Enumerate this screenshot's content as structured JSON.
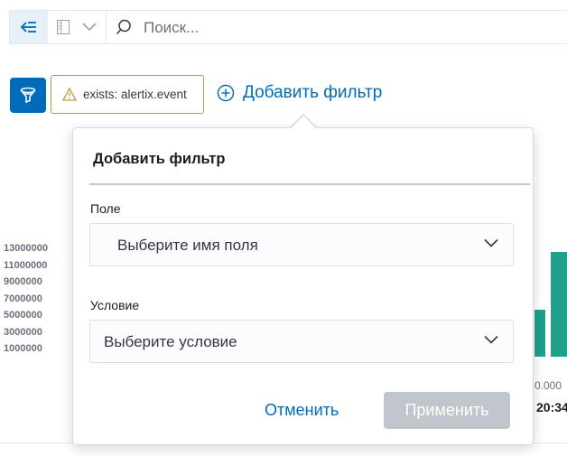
{
  "query_bar": {
    "search_placeholder": "Поиск..."
  },
  "filters": {
    "pill_label": "exists: alertix.event",
    "add_filter_label": "Добавить фильтр"
  },
  "chart_data": {
    "type": "bar",
    "yticks": [
      "13000000",
      "11000000",
      "9000000",
      "7000000",
      "5000000",
      "3000000",
      "1000000"
    ],
    "x_label_partial": "0.000",
    "time_label_partial": "20:34",
    "series_color": "#20a08a"
  },
  "popover": {
    "title": "Добавить фильтр",
    "field_label": "Поле",
    "field_placeholder": "Выберите имя поля",
    "operator_label": "Условие",
    "operator_placeholder": "Выберите условие",
    "cancel_label": "Отменить",
    "apply_label": "Применить"
  },
  "colors": {
    "accent": "#006bb8",
    "warning_border": "#b89a3d",
    "disabled_button": "#c1c6cc"
  },
  "icons": [
    "menu-collapse-icon",
    "panel-icon",
    "chevron-down-icon",
    "search-icon",
    "filter-funnel-icon",
    "warning-icon",
    "plus-circle-icon"
  ]
}
